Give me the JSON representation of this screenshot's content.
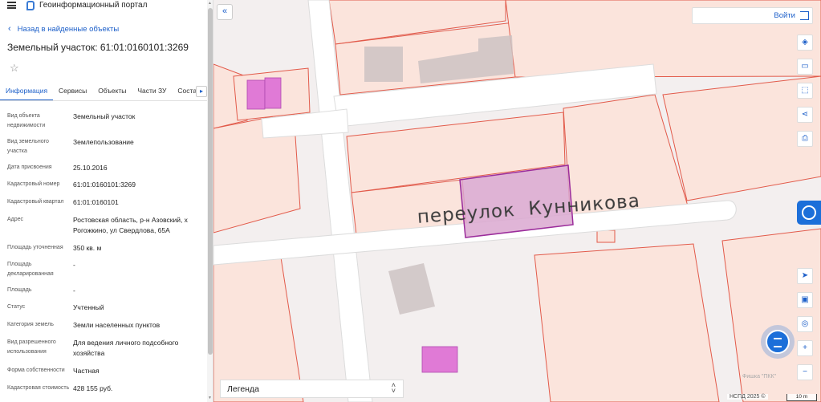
{
  "header": {
    "app_title": "Геоинформационный портал"
  },
  "nav": {
    "back_label": "Назад в найденные объекты"
  },
  "object": {
    "title": "Земельный участок: 61:01:0160101:3269"
  },
  "tabs": [
    {
      "label": "Информация",
      "active": true
    },
    {
      "label": "Сервисы",
      "active": false
    },
    {
      "label": "Объекты",
      "active": false
    },
    {
      "label": "Части ЗУ",
      "active": false
    },
    {
      "label": "Состав",
      "active": false
    }
  ],
  "info": [
    {
      "label": "Вид объекта недвижимости",
      "value": "Земельный участок"
    },
    {
      "label": "Вид земельного участка",
      "value": "Землепользование"
    },
    {
      "label": "Дата присвоения",
      "value": "25.10.2016"
    },
    {
      "label": "Кадастровый номер",
      "value": "61:01:0160101:3269"
    },
    {
      "label": "Кадастровый квартал",
      "value": "61:01:0160101"
    },
    {
      "label": "Адрес",
      "value": "Ростовская область, р-н Азовский, х Рогожкино, ул Свердлова, 65А"
    },
    {
      "label": "Площадь уточненная",
      "value": "350 кв. м"
    },
    {
      "label": "Площадь декларированная",
      "value": "-"
    },
    {
      "label": "Площадь",
      "value": "-"
    },
    {
      "label": "Статус",
      "value": "Учтенный"
    },
    {
      "label": "Категория земель",
      "value": "Земли населенных пунктов"
    },
    {
      "label": "Вид разрешенного использования",
      "value": "Для ведения личного подсобного хозяйства"
    },
    {
      "label": "Форма собственности",
      "value": "Частная"
    },
    {
      "label": "Кадастровая стоимость",
      "value": "428 155 руб."
    }
  ],
  "map": {
    "street_label": "переулок  Кунникова",
    "login_label": "Войти",
    "legend_label": "Легенда",
    "copyright": "НСПД 2025 ©",
    "scale_label": "10 m",
    "watermark": "Фишка \"ПКК\""
  },
  "colors": {
    "accent": "#1c5fc9",
    "parcel_border": "#e25a4a",
    "parcel_fill": "#fbe4dc",
    "selected_fill": "#dba8d0",
    "selected_border": "#9b2c9b",
    "building_fill": "#c9c0c0",
    "purple_fill": "#e07ad6"
  },
  "icons": {
    "layers": "layers-icon",
    "measure": "ruler-icon",
    "select_area": "select-area-icon",
    "share": "share-icon",
    "print": "print-icon",
    "locate": "locate-icon",
    "basemap": "basemap-icon",
    "search_place": "place-search-icon",
    "zoom_in": "plus-icon",
    "zoom_out": "minus-icon"
  }
}
